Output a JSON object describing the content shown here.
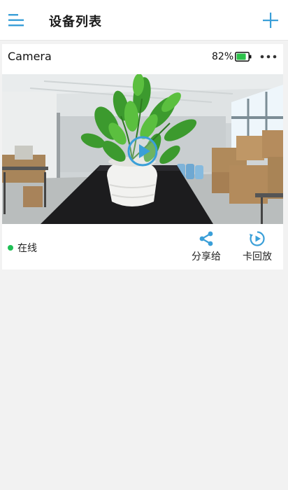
{
  "header": {
    "title": "设备列表",
    "menu_icon": "menu-icon",
    "add_icon": "plus-icon"
  },
  "device": {
    "name": "Camera",
    "battery_percent": "82%",
    "battery_level": 0.82,
    "more_icon": "more-dots-icon",
    "play_icon": "play-icon",
    "status": "在线",
    "actions": {
      "share_label": "分享给",
      "playback_label": "卡回放"
    }
  },
  "colors": {
    "accent": "#3a9fd8",
    "online": "#1fbf55",
    "battery": "#2cc24a"
  }
}
